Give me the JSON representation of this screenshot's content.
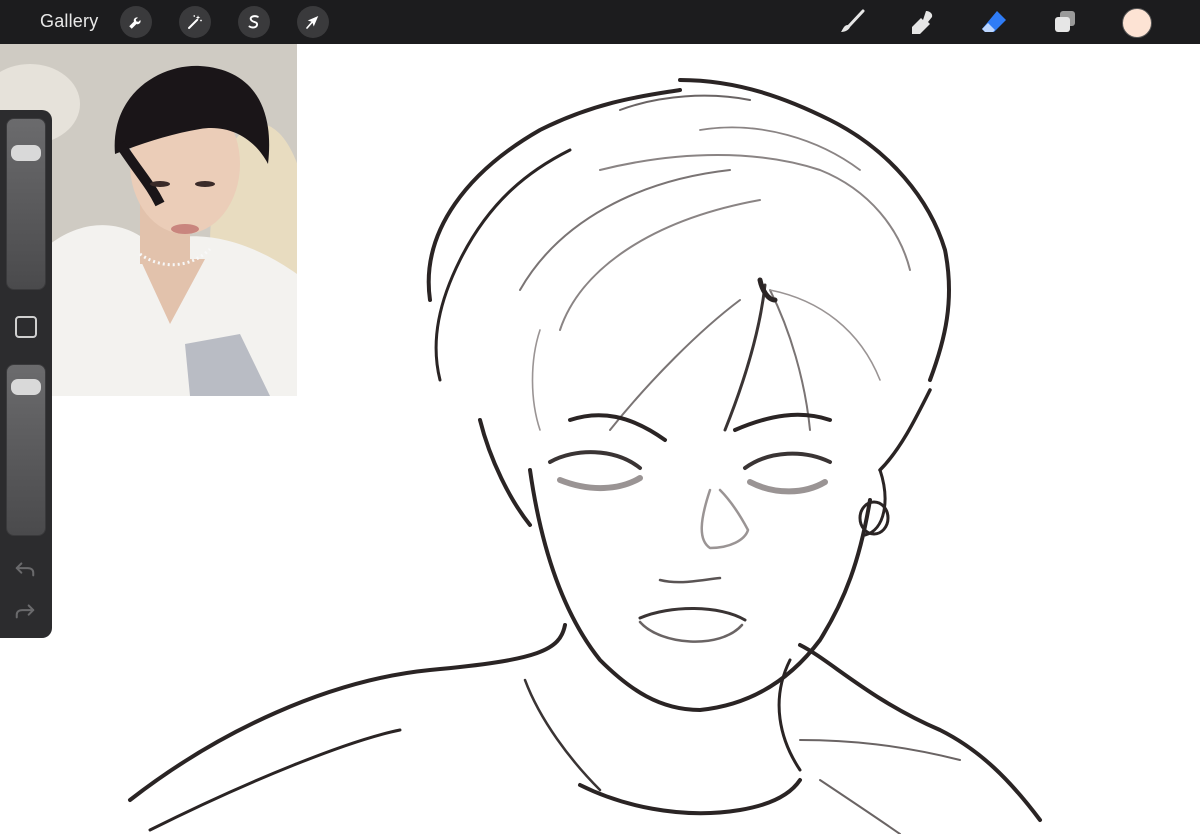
{
  "toolbar": {
    "gallery_label": "Gallery",
    "left_tools": [
      {
        "name": "actions",
        "icon": "wrench-icon"
      },
      {
        "name": "adjustments",
        "icon": "magic-wand-icon"
      },
      {
        "name": "selection",
        "icon": "selection-s-icon"
      },
      {
        "name": "transform",
        "icon": "arrow-cursor-icon"
      }
    ],
    "right_tools": [
      {
        "name": "brush",
        "icon": "brush-icon",
        "active": false
      },
      {
        "name": "smudge",
        "icon": "smudge-icon",
        "active": false
      },
      {
        "name": "eraser",
        "icon": "eraser-icon",
        "active": true
      },
      {
        "name": "layers",
        "icon": "layers-icon",
        "active": false
      }
    ],
    "current_color": "#fde3d4",
    "accent_color": "#2f7cf6"
  },
  "sidebar": {
    "brush_size_level": 0.15,
    "opacity_level": 0.07,
    "modify_button": "square-icon",
    "undo": "undo-icon",
    "redo": "redo-icon"
  },
  "reference_panel": {
    "content": "reference-photo"
  },
  "canvas": {
    "content": "line-art-portrait-sketch"
  }
}
